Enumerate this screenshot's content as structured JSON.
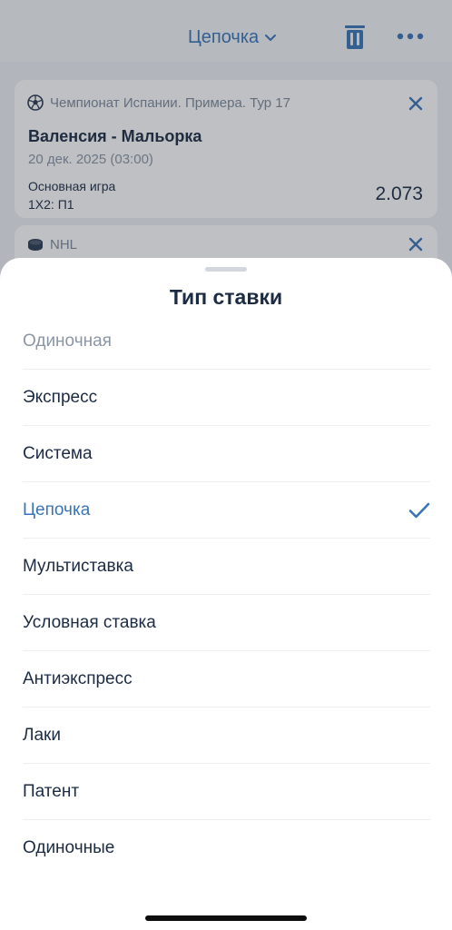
{
  "header": {
    "bet_mode_label": "Цепочка"
  },
  "coupon": {
    "cards": [
      {
        "league": "Чемпионат Испании. Примера. Тур 17",
        "match": "Валенсия - Мальорка",
        "date": "20 дек. 2025 (03:00)",
        "market": "Основная игра",
        "outcome": "1X2: П1",
        "odds": "2.073"
      },
      {
        "league": "NHL"
      }
    ]
  },
  "sheet": {
    "title": "Тип ставки",
    "options": [
      {
        "label": "Одиночная",
        "state": "disabled"
      },
      {
        "label": "Экспресс"
      },
      {
        "label": "Система"
      },
      {
        "label": "Цепочка",
        "state": "selected"
      },
      {
        "label": "Мультиставка"
      },
      {
        "label": "Условная ставка"
      },
      {
        "label": "Антиэкспресс"
      },
      {
        "label": "Лаки"
      },
      {
        "label": "Патент"
      },
      {
        "label": "Одиночные"
      }
    ]
  },
  "colors": {
    "accent": "#3a74b8",
    "text": "#1c2b44",
    "muted": "#8b95a5"
  },
  "icons": [
    "chevron-down-icon",
    "trash-icon",
    "more-icon",
    "soccer-ball-icon",
    "hockey-puck-icon",
    "close-icon",
    "check-icon"
  ]
}
